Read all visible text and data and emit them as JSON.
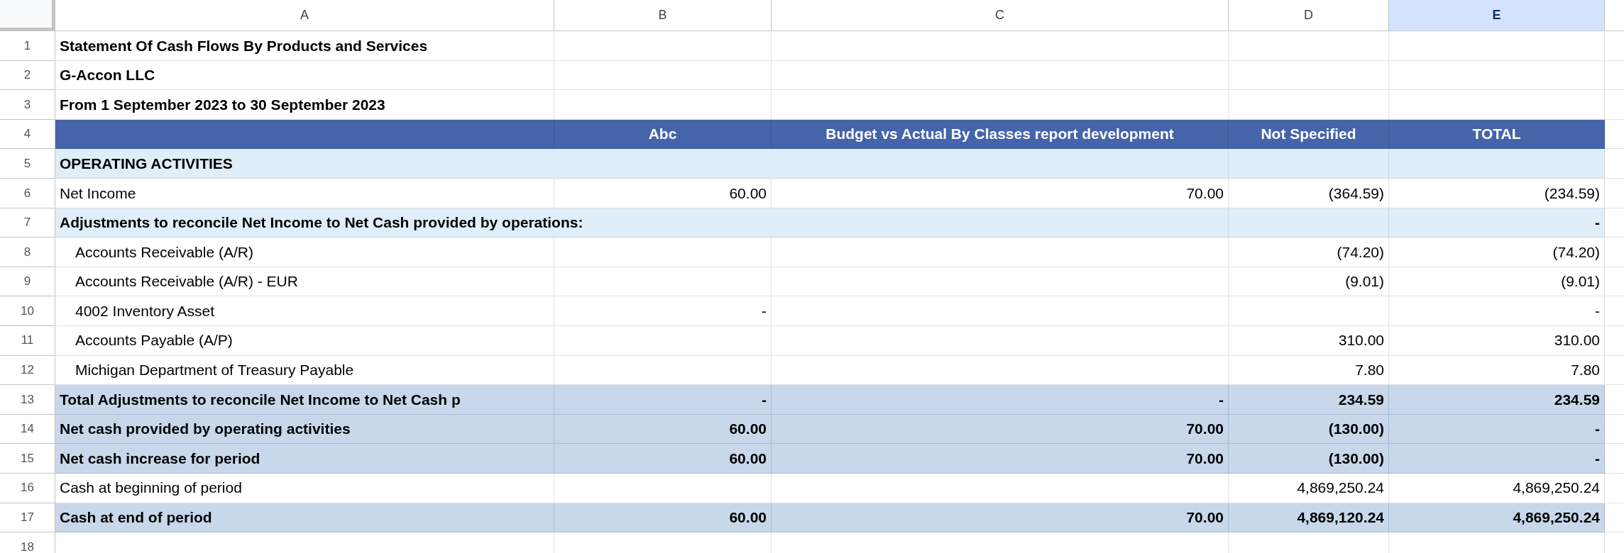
{
  "columns": [
    {
      "label": "A",
      "selected": false
    },
    {
      "label": "B",
      "selected": false
    },
    {
      "label": "C",
      "selected": false
    },
    {
      "label": "D",
      "selected": false
    },
    {
      "label": "E",
      "selected": true
    }
  ],
  "rows": [
    {
      "number": "1",
      "kind": "title",
      "a": "Statement Of Cash Flows By Products and Services"
    },
    {
      "number": "2",
      "kind": "title",
      "a": "G-Accon LLC"
    },
    {
      "number": "3",
      "kind": "title",
      "a": "From 1 September 2023 to 30 September 2023"
    },
    {
      "number": "4",
      "kind": "header",
      "b": "Abc",
      "c": "Budget vs Actual By Classes report development",
      "d": "Not Specified",
      "e": "TOTAL"
    },
    {
      "number": "5",
      "kind": "section",
      "a": "OPERATING ACTIVITIES"
    },
    {
      "number": "6",
      "kind": "detail",
      "a": "Net Income",
      "b": "60.00",
      "c": "70.00",
      "d": "(364.59)",
      "e": "(234.59)"
    },
    {
      "number": "7",
      "kind": "section",
      "a": "Adjustments to reconcile Net Income to Net Cash provided by operations:",
      "e": "-",
      "children": [
        {
          "number": "8",
          "kind": "detail",
          "a": "Accounts Receivable (A/R)",
          "d": "(74.20)",
          "e": "(74.20)"
        },
        {
          "number": "9",
          "kind": "detail",
          "a": "Accounts Receivable (A/R) - EUR",
          "d": "(9.01)",
          "e": "(9.01)"
        },
        {
          "number": "10",
          "kind": "detail",
          "a": "4002 Inventory Asset",
          "b": "-",
          "e": "-"
        },
        {
          "number": "11",
          "kind": "detail",
          "a": "Accounts Payable (A/P)",
          "d": "310.00",
          "e": "310.00"
        },
        {
          "number": "12",
          "kind": "detail",
          "a": "Michigan Department of Treasury Payable",
          "d": "7.80",
          "e": "7.80"
        }
      ]
    },
    {
      "number": "13",
      "kind": "total",
      "a": "Total Adjustments to reconcile Net Income to Net Cash p",
      "b": "-",
      "c": "-",
      "d": "234.59",
      "e": "234.59"
    },
    {
      "number": "14",
      "kind": "total",
      "a": "Net cash provided by operating activities",
      "b": "60.00",
      "c": "70.00",
      "d": "(130.00)",
      "e": "-"
    },
    {
      "number": "15",
      "kind": "total",
      "a": "Net cash increase for period",
      "b": "60.00",
      "c": "70.00",
      "d": "(130.00)",
      "e": "-"
    },
    {
      "number": "16",
      "kind": "detail",
      "a": "Cash at beginning of period",
      "d": "4,869,250.24",
      "e": "4,869,250.24"
    },
    {
      "number": "17",
      "kind": "total",
      "a": "Cash at end of period",
      "b": "60.00",
      "c": "70.00",
      "d": "4,869,120.24",
      "e": "4,869,250.24"
    },
    {
      "number": "18",
      "kind": "detail"
    }
  ]
}
